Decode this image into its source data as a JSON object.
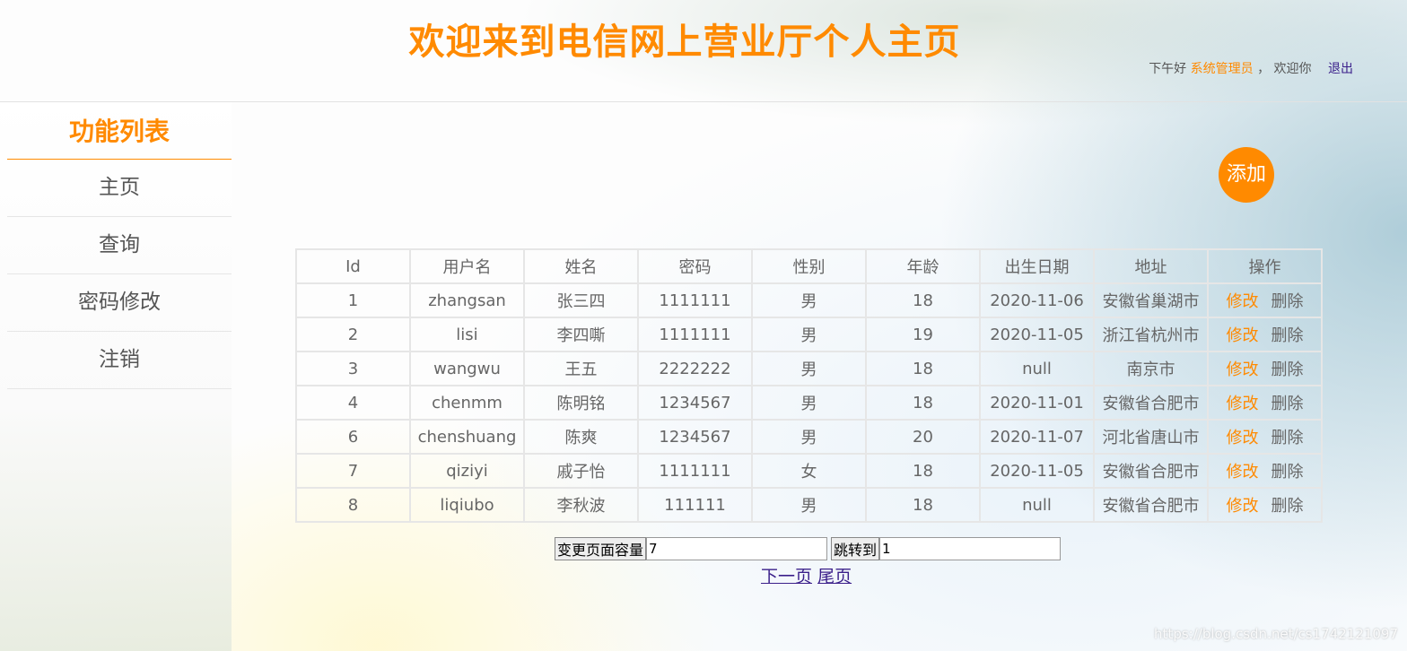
{
  "header": {
    "title": "欢迎来到电信网上营业厅个人主页",
    "greeting_prefix": "下午好",
    "user_role": "系统管理员",
    "greeting_suffix": "，  欢迎你",
    "logout_label": "退出"
  },
  "sidebar": {
    "title": "功能列表",
    "items": [
      {
        "label": "主页"
      },
      {
        "label": "查询"
      },
      {
        "label": "密码修改"
      },
      {
        "label": "注销"
      }
    ]
  },
  "add_button_label": "添加",
  "table": {
    "headers": [
      "Id",
      "用户名",
      "姓名",
      "密码",
      "性别",
      "年龄",
      "出生日期",
      "地址",
      "操作"
    ],
    "edit_label": "修改",
    "delete_label": "删除",
    "rows": [
      [
        "1",
        "zhangsan",
        "张三四",
        "1111111",
        "男",
        "18",
        "2020-11-06",
        "安徽省巢湖市"
      ],
      [
        "2",
        "lisi",
        "李四嘶",
        "1111111",
        "男",
        "19",
        "2020-11-05",
        "浙江省杭州市"
      ],
      [
        "3",
        "wangwu",
        "王五",
        "2222222",
        "男",
        "18",
        "null",
        "南京市"
      ],
      [
        "4",
        "chenmm",
        "陈明铭",
        "1234567",
        "男",
        "18",
        "2020-11-01",
        "安徽省合肥市"
      ],
      [
        "6",
        "chenshuang",
        "陈爽",
        "1234567",
        "男",
        "20",
        "2020-11-07",
        "河北省唐山市"
      ],
      [
        "7",
        "qiziyi",
        "戚子怡",
        "1111111",
        "女",
        "18",
        "2020-11-05",
        "安徽省合肥市"
      ],
      [
        "8",
        "liqiubo",
        "李秋波",
        "111111",
        "男",
        "18",
        "null",
        "安徽省合肥市"
      ]
    ]
  },
  "pager": {
    "page_size_button": "变更页面容量",
    "page_size_value": "7",
    "jump_button": "跳转到",
    "jump_value": "1",
    "next_label": "下一页",
    "last_label": "尾页"
  },
  "watermark": "https://blog.csdn.net/cs1742121097"
}
